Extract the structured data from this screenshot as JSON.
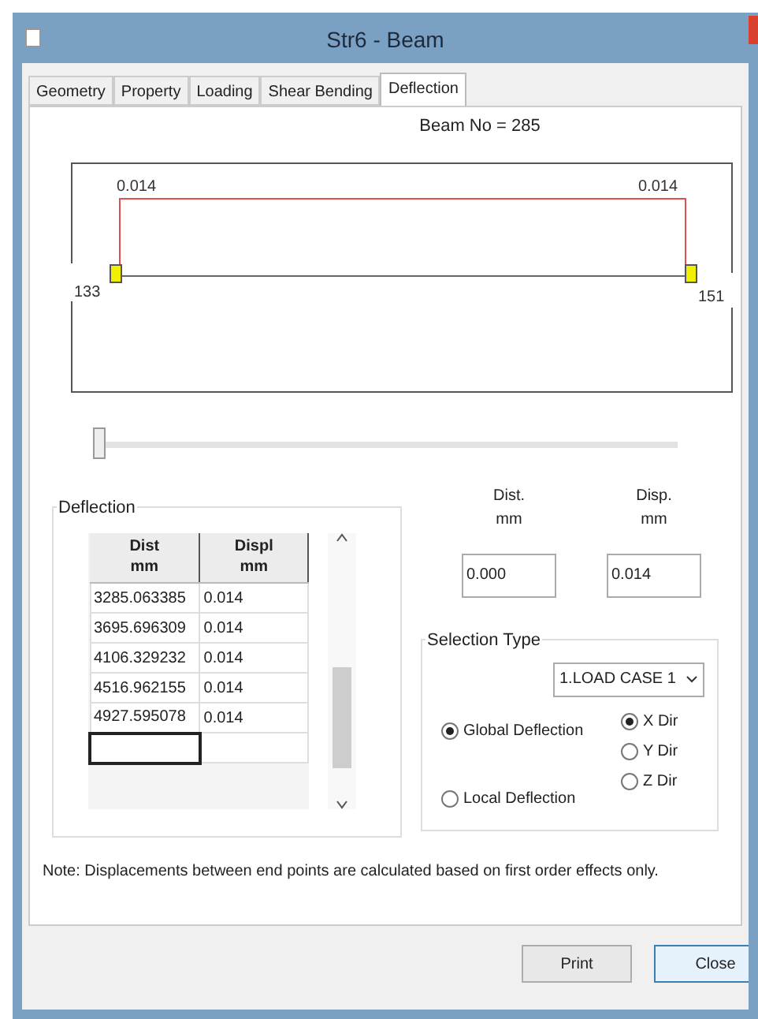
{
  "window": {
    "title": "Str6 - Beam"
  },
  "tabs": [
    {
      "label": "Geometry",
      "selected": false
    },
    {
      "label": "Property",
      "selected": false
    },
    {
      "label": "Loading",
      "selected": false
    },
    {
      "label": "Shear Bending",
      "selected": false
    },
    {
      "label": "Deflection",
      "selected": true
    }
  ],
  "beam_label": "Beam No = 285",
  "diagram": {
    "start_node": "133",
    "end_node": "151",
    "start_value": "0.014",
    "end_value": "0.014"
  },
  "slider": {
    "level": 0
  },
  "deflection_group": {
    "title": "Deflection",
    "columns": [
      "Dist\nmm",
      "Displ\nmm"
    ],
    "rows": [
      [
        "3285.063385",
        "0.014"
      ],
      [
        "3695.696309",
        "0.014"
      ],
      [
        "4106.329232",
        "0.014"
      ],
      [
        "4516.962155",
        "0.014"
      ],
      [
        "4927.595078",
        "0.014"
      ]
    ]
  },
  "dist_label": "Dist.\nmm",
  "disp_label": "Disp.\nmm",
  "dist_value": "0.000",
  "disp_value": "0.014",
  "selection_type": {
    "title": "Selection Type",
    "load_case": "1.LOAD CASE 1",
    "modes": [
      {
        "label": "Global Deflection",
        "selected": true
      },
      {
        "label": "Local Deflection",
        "selected": false
      }
    ],
    "directions": [
      {
        "label": "X Dir",
        "selected": true
      },
      {
        "label": "Y Dir",
        "selected": false
      },
      {
        "label": "Z Dir",
        "selected": false
      }
    ]
  },
  "note": "Note: Displacements between end points are calculated based on first order effects only.",
  "buttons": [
    {
      "label": "Print",
      "selected": false
    },
    {
      "label": "Close",
      "selected": true
    }
  ]
}
